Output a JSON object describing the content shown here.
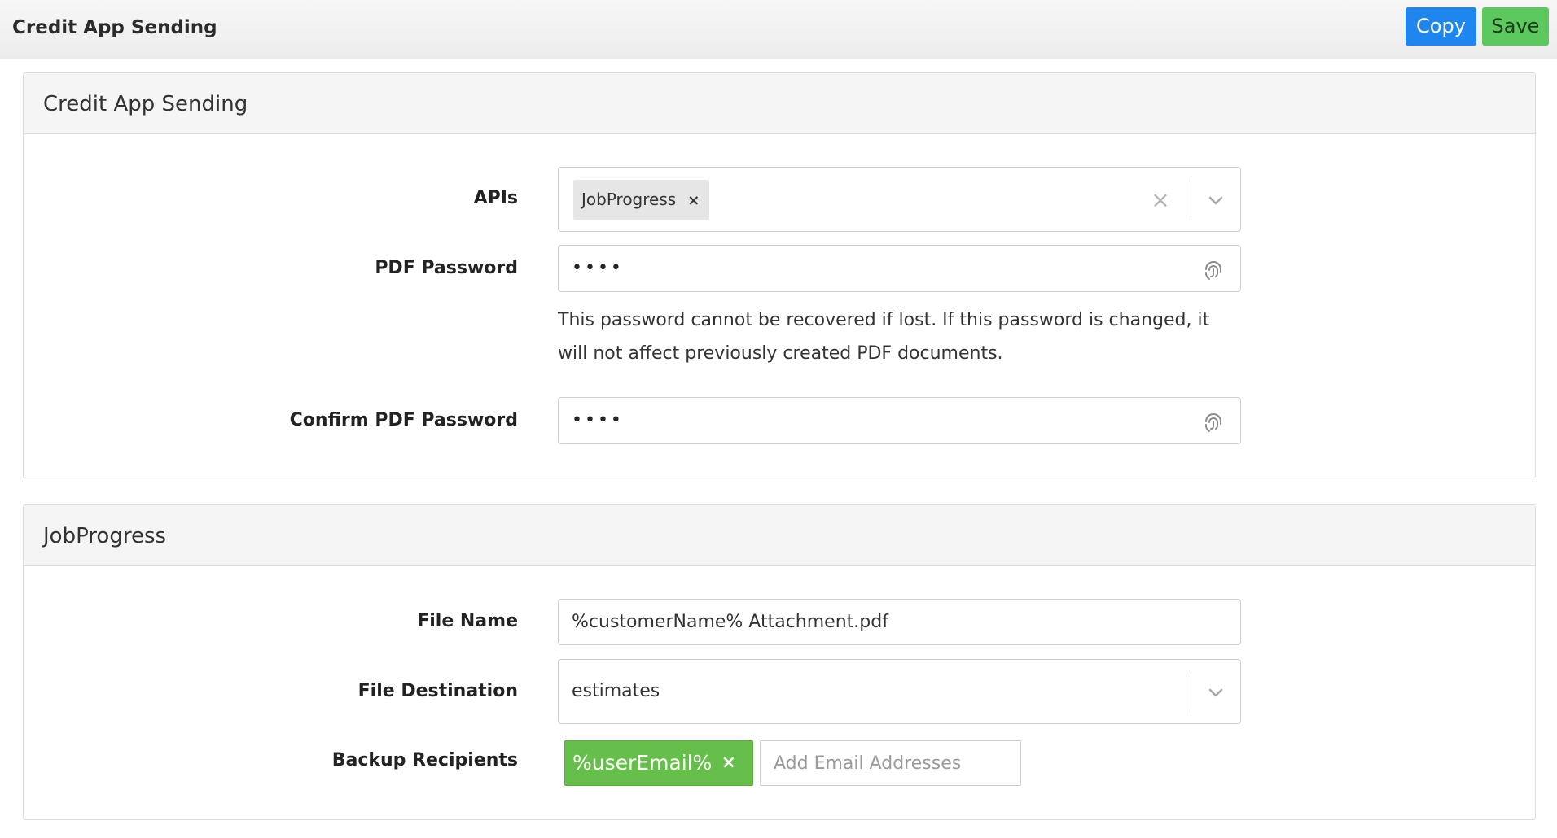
{
  "header": {
    "title": "Credit App Sending",
    "copy_label": "Copy",
    "save_label": "Save"
  },
  "colors": {
    "copy_button": "#1f86f0",
    "save_button": "#5cc95f",
    "recipient_tag": "#66bf4a"
  },
  "credit_app_panel": {
    "title": "Credit App Sending",
    "apis": {
      "label": "APIs",
      "selected": [
        "JobProgress"
      ],
      "clear_icon": "clear-icon",
      "dropdown_icon": "chevron-down-icon"
    },
    "pdf_password": {
      "label": "PDF Password",
      "value": "••••",
      "icon": "fingerprint-icon",
      "help": "This password cannot be recovered if lost. If this password is changed, it will not affect previously created PDF documents."
    },
    "confirm_pdf_password": {
      "label": "Confirm PDF Password",
      "value": "••••",
      "icon": "fingerprint-icon"
    }
  },
  "jobprogress_panel": {
    "title": "JobProgress",
    "file_name": {
      "label": "File Name",
      "value": "%customerName% Attachment.pdf"
    },
    "file_destination": {
      "label": "File Destination",
      "value": "estimates",
      "dropdown_icon": "chevron-down-icon"
    },
    "backup_recipients": {
      "label": "Backup Recipients",
      "tags": [
        "%userEmail%"
      ],
      "remove_glyph": "×",
      "placeholder": "Add Email Addresses"
    }
  }
}
